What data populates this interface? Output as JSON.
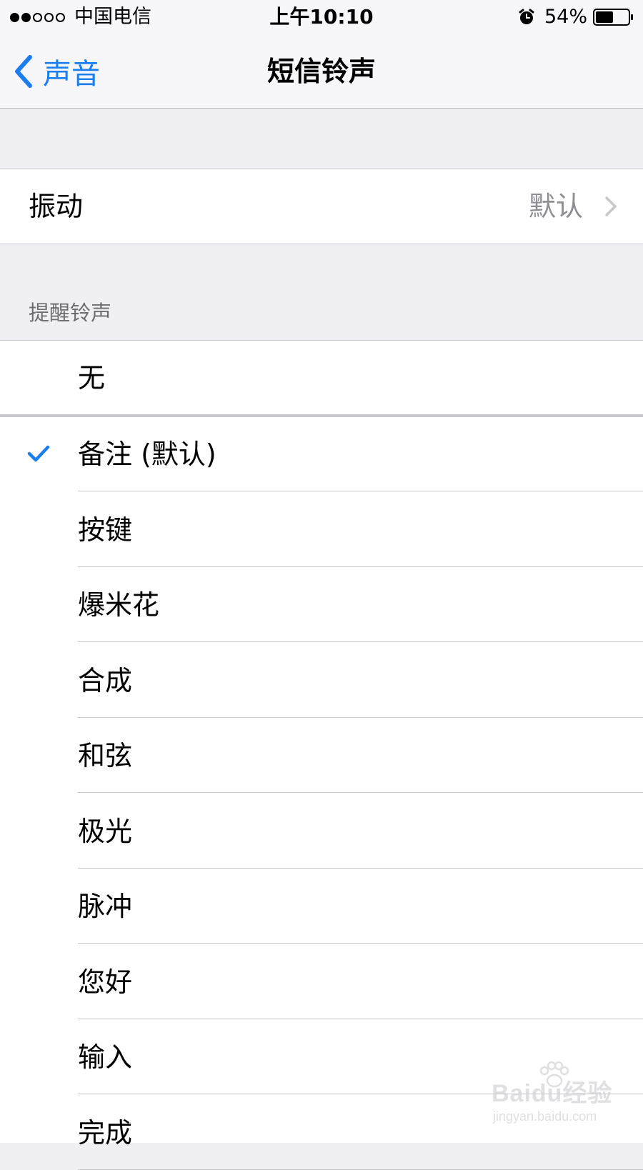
{
  "status_bar": {
    "signal_filled": 2,
    "signal_total": 5,
    "carrier": "中国电信",
    "time": "上午10:10",
    "battery_percent": "54%",
    "battery_level": 0.54,
    "alarm_icon": "alarm-clock-icon"
  },
  "nav": {
    "back_label": "声音",
    "title": "短信铃声",
    "accent_color": "#1a7ef0"
  },
  "vibration": {
    "label": "振动",
    "value": "默认"
  },
  "section": {
    "header": "提醒铃声"
  },
  "none_option": {
    "label": "无"
  },
  "tones": [
    {
      "label": "备注 (默认)",
      "selected": true
    },
    {
      "label": "按键",
      "selected": false
    },
    {
      "label": "爆米花",
      "selected": false
    },
    {
      "label": "合成",
      "selected": false
    },
    {
      "label": "和弦",
      "selected": false
    },
    {
      "label": "极光",
      "selected": false
    },
    {
      "label": "脉冲",
      "selected": false
    },
    {
      "label": "您好",
      "selected": false
    },
    {
      "label": "输入",
      "selected": false
    },
    {
      "label": "完成",
      "selected": false
    }
  ],
  "watermark": {
    "main": "Baidu经验",
    "sub": "jingyan.baidu.com"
  }
}
